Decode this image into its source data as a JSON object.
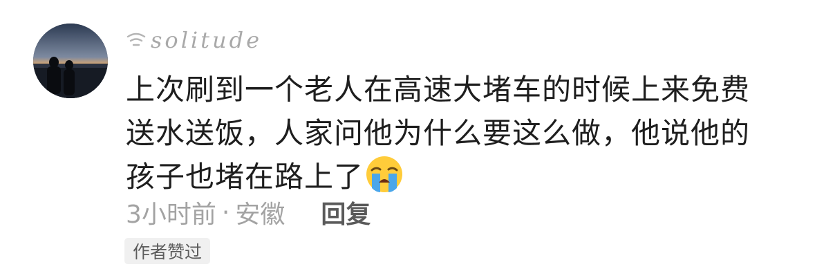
{
  "comment": {
    "username": "solitude",
    "username_icon": "signal-wave-icon",
    "text": "上次刷到一个老人在高速大堵车的时候上来免费送水送饭，人家问他为什么要这么做，他说他的孩子也堵在路上了",
    "emoji": "loudly-crying-face-emoji",
    "time": "3小时前",
    "separator": "·",
    "location": "安徽",
    "reply_label": "回复",
    "badge": "作者赞过"
  },
  "colors": {
    "text": "#1e1e1e",
    "meta": "#a3a3a3",
    "username": "#a9a9a9",
    "badge_bg": "#f0f0f0"
  }
}
